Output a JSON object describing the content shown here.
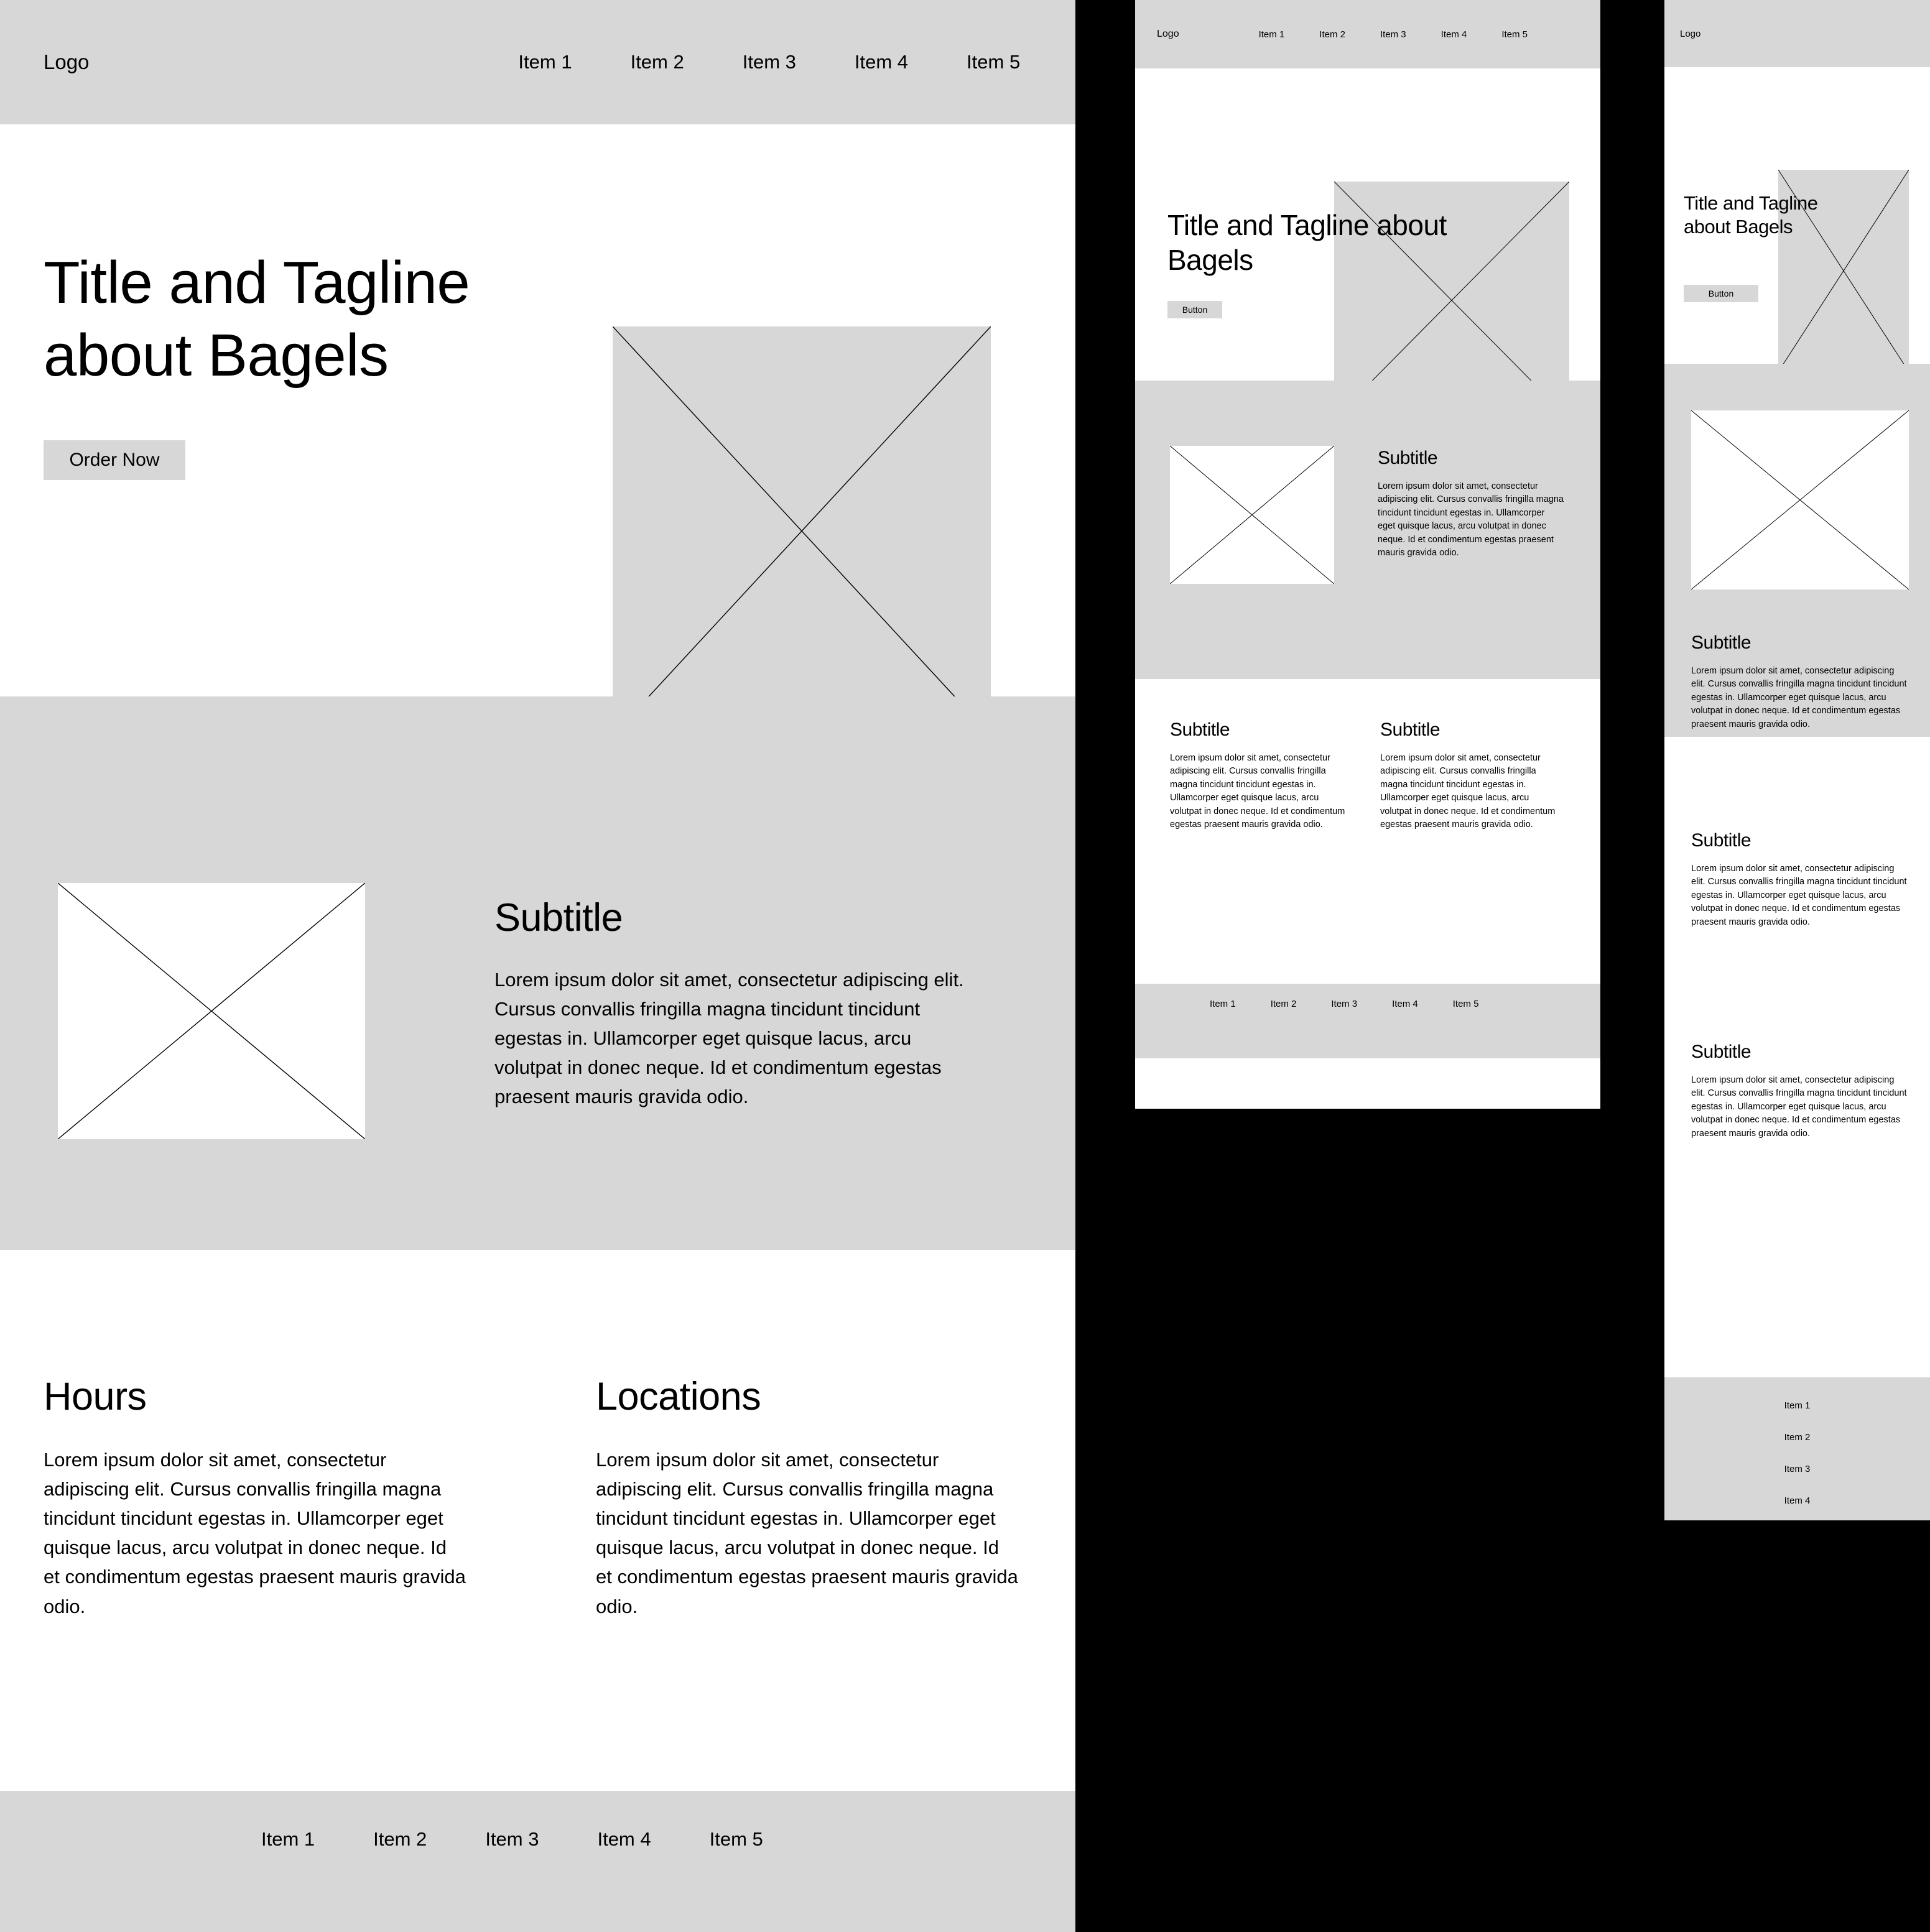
{
  "brand": {
    "logo": "Logo"
  },
  "colors": {
    "surface": "#ffffff",
    "panel_grey": "#d7d7d7",
    "canvas": "#000000",
    "text": "#000000"
  },
  "nav": {
    "items": [
      "Item 1",
      "Item 2",
      "Item 3",
      "Item 4",
      "Item 5"
    ]
  },
  "footer": {
    "items": [
      "Item 1",
      "Item 2",
      "Item 3",
      "Item 4",
      "Item 5"
    ]
  },
  "hero": {
    "title": "Title and Tagline about Bagels",
    "cta_desktop": "Order Now",
    "cta_compact": "Button",
    "image_placeholder": "image-placeholder"
  },
  "feature": {
    "heading": "Subtitle",
    "body": "Lorem ipsum dolor sit amet, consectetur adipiscing elit. Cursus convallis fringilla magna tincidunt tincidunt egestas in. Ullamcorper eget quisque lacus, arcu volutpat in donec neque. Id et condimentum egestas praesent mauris gravida odio."
  },
  "desktop_columns": [
    {
      "heading": "Hours",
      "body": "Lorem ipsum dolor sit amet, consectetur adipiscing elit. Cursus convallis fringilla magna tincidunt tincidunt egestas in. Ullamcorper eget quisque lacus, arcu volutpat in donec neque. Id et condimentum egestas praesent mauris gravida odio."
    },
    {
      "heading": "Locations",
      "body": "Lorem ipsum dolor sit amet, consectetur adipiscing elit. Cursus convallis fringilla magna tincidunt tincidunt egestas in. Ullamcorper eget quisque lacus, arcu volutpat in donec neque. Id et condimentum egestas praesent mauris gravida odio."
    }
  ],
  "compact_columns": [
    {
      "heading": "Subtitle",
      "body": "Lorem ipsum dolor sit amet, consectetur adipiscing elit. Cursus convallis fringilla magna tincidunt tincidunt egestas in. Ullamcorper eget quisque lacus, arcu volutpat in donec neque. Id et condimentum egestas praesent mauris gravida odio."
    },
    {
      "heading": "Subtitle",
      "body": "Lorem ipsum dolor sit amet, consectetur adipiscing elit. Cursus convallis fringilla magna tincidunt tincidunt egestas in. Ullamcorper eget quisque lacus, arcu volutpat in donec neque. Id et condimentum egestas praesent mauris gravida odio."
    }
  ]
}
